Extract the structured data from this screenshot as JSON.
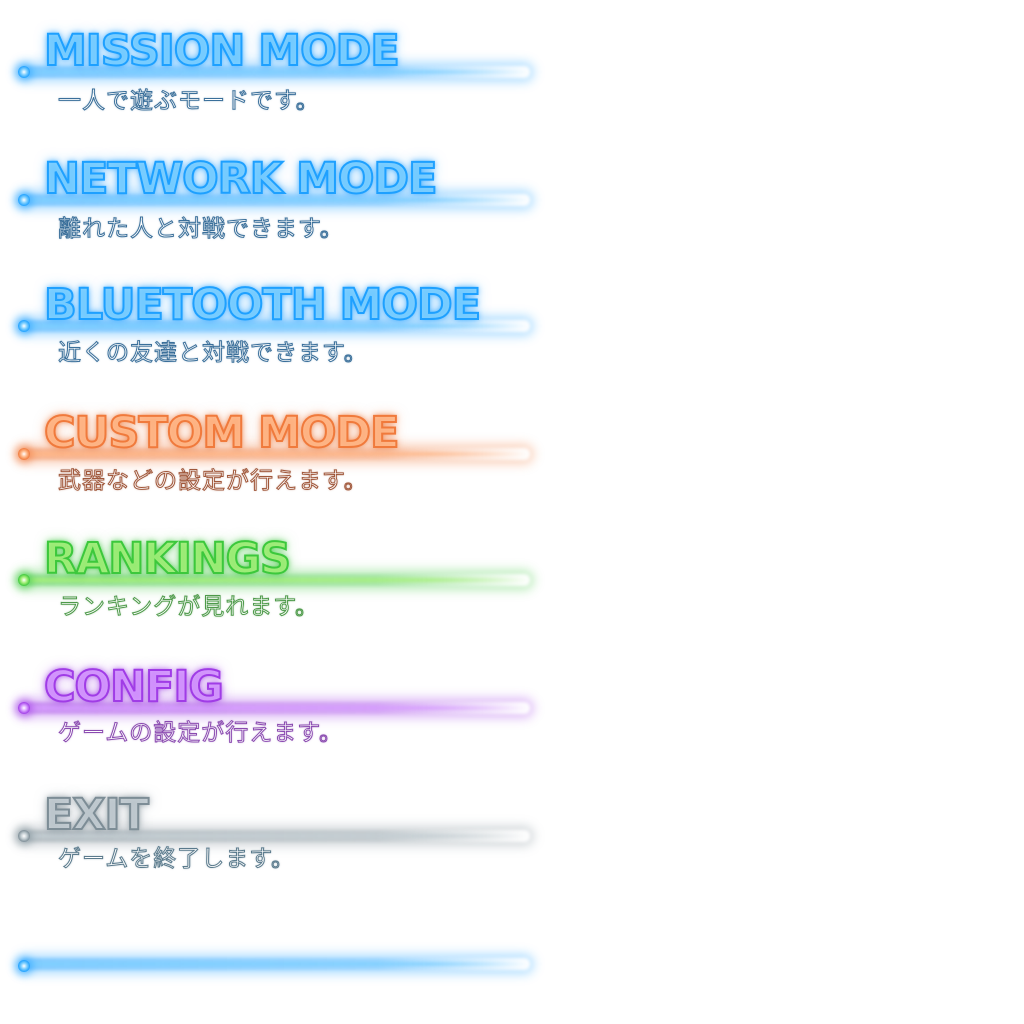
{
  "menu": {
    "items": [
      {
        "title": "MISSION MODE",
        "description": "一人で遊ぶモードです。",
        "color": "#1ea0ff",
        "light": "#7fd0ff",
        "desc_color": "#3a6f9a"
      },
      {
        "title": "NETWORK MODE",
        "description": "離れた人と対戦できます。",
        "color": "#1ea0ff",
        "light": "#7fd0ff",
        "desc_color": "#3a6f9a"
      },
      {
        "title": "BLUETOOTH MODE",
        "description": "近くの友達と対戦できます。",
        "color": "#1ea0ff",
        "light": "#7fd0ff",
        "desc_color": "#3a6f9a"
      },
      {
        "title": "CUSTOM MODE",
        "description": "武器などの設定が行えます。",
        "color": "#f07a3c",
        "light": "#ffb889",
        "desc_color": "#a0573a"
      },
      {
        "title": "RANKINGS",
        "description": "ランキングが見れます。",
        "color": "#3cc83c",
        "light": "#a6f07a",
        "desc_color": "#4e9a4a"
      },
      {
        "title": "CONFIG",
        "description": "ゲームの設定が行えます。",
        "color": "#a03ce6",
        "light": "#d69bff",
        "desc_color": "#8a4ab0"
      },
      {
        "title": "EXIT",
        "description": "ゲームを終了します。",
        "color": "#7d8d96",
        "light": "#c4ced3",
        "desc_color": "#5a7a8c"
      }
    ],
    "footer_line_color": "#1ea0ff"
  }
}
